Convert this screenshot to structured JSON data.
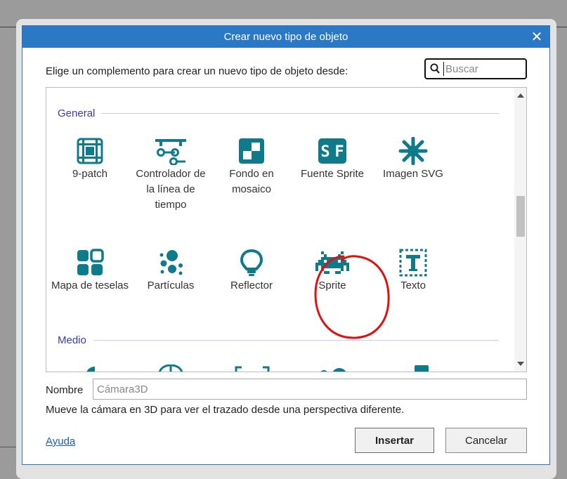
{
  "dialog": {
    "title": "Crear nuevo tipo de objeto",
    "prompt": "Elige un complemento para crear un nuevo tipo de objeto desde:",
    "search": {
      "placeholder": "Buscar",
      "value": ""
    },
    "sections": [
      {
        "title": "General",
        "items": [
          {
            "label": "9-patch",
            "icon": "nine-patch-icon"
          },
          {
            "label": "Controlador de la línea de tiempo",
            "icon": "timeline-controller-icon"
          },
          {
            "label": "Fondo en mosaico",
            "icon": "tiled-background-icon"
          },
          {
            "label": "Fuente Sprite",
            "icon": "sprite-font-icon"
          },
          {
            "label": "Imagen SVG",
            "icon": "svg-image-icon"
          },
          {
            "label": "Mapa de teselas",
            "icon": "tilemap-icon"
          },
          {
            "label": "Partículas",
            "icon": "particles-icon"
          },
          {
            "label": "Reflector",
            "icon": "spotlight-icon"
          },
          {
            "label": "Sprite",
            "icon": "sprite-invader-icon"
          },
          {
            "label": "Texto",
            "icon": "text-icon"
          }
        ]
      },
      {
        "title": "Medio",
        "items": []
      }
    ],
    "name_label": "Nombre",
    "name_input": {
      "placeholder": "Cámara3D",
      "value": ""
    },
    "description": "Mueve la cámara en 3D para ver el trazado desde una perspectiva diferente.",
    "help_link": "Ayuda",
    "insert_button": "Insertar",
    "cancel_button": "Cancelar",
    "colors": {
      "titlebar": "#2b78c4",
      "icon": "#0f7a8a",
      "section": "#3a3aa8",
      "annotation": "#e01010"
    }
  }
}
